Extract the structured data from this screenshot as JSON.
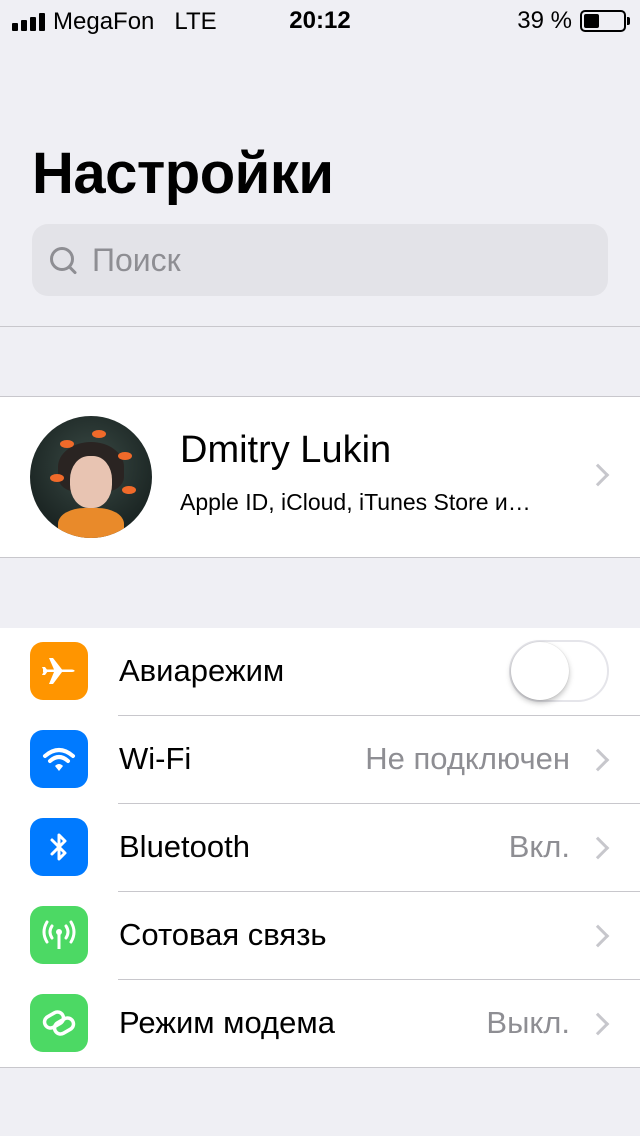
{
  "status_bar": {
    "carrier": "MegaFon",
    "network": "LTE",
    "time": "20:12",
    "battery_percent": "39 %",
    "battery_level": 0.39,
    "signal_bars": 4
  },
  "header": {
    "title": "Настройки"
  },
  "search": {
    "placeholder": "Поиск",
    "icon": "search-icon"
  },
  "profile": {
    "name": "Dmitry Lukin",
    "subtitle": "Apple ID, iCloud, iTunes Store и…"
  },
  "settings": {
    "airplane": {
      "label": "Авиарежим",
      "icon": "airplane-icon",
      "color": "#ff9500",
      "enabled": false
    },
    "wifi": {
      "label": "Wi-Fi",
      "value": "Не подключен",
      "icon": "wifi-icon",
      "color": "#007aff"
    },
    "bluetooth": {
      "label": "Bluetooth",
      "value": "Вкл.",
      "icon": "bluetooth-icon",
      "color": "#007aff"
    },
    "cellular": {
      "label": "Сотовая связь",
      "icon": "cellular-icon",
      "color": "#4cd964"
    },
    "hotspot": {
      "label": "Режим модема",
      "value": "Выкл.",
      "icon": "hotspot-icon",
      "color": "#4cd964"
    }
  },
  "colors": {
    "background": "#efeff4",
    "separator": "#c8c7cc",
    "secondary_text": "#8e8e93"
  }
}
